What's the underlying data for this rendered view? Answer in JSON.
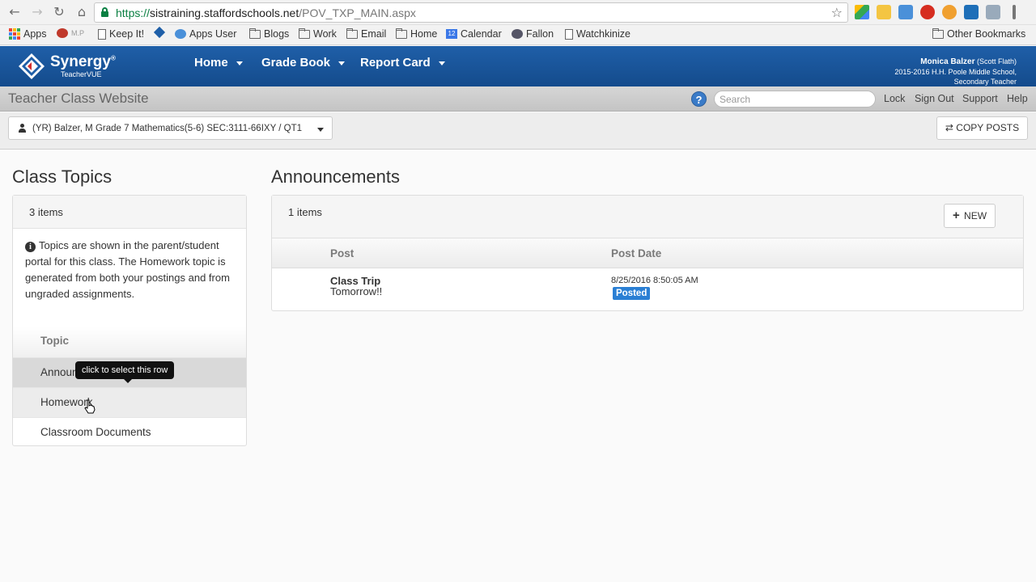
{
  "browser": {
    "url_scheme": "https://",
    "url_host": "sistraining.staffordschools.net",
    "url_path": "/POV_TXP_MAIN.aspx",
    "bookmarks": [
      "Apps",
      "M.P",
      "Keep It!",
      "Apps User",
      "Blogs",
      "Work",
      "Email",
      "Home",
      "Calendar",
      "Fallon",
      "Watchkinize"
    ],
    "other_bookmarks": "Other Bookmarks",
    "calendar_badge": "12"
  },
  "app": {
    "logo": "Synergy",
    "logo_mark": "®",
    "logo_sub": "TeacherVUE",
    "nav": [
      "Home",
      "Grade Book",
      "Report Card"
    ],
    "user_name": "Monica Balzer",
    "user_alt": "(Scott Flath)",
    "user_school": "2015-2016 H.H. Poole Middle School,",
    "user_role": "Secondary Teacher"
  },
  "titlebar": {
    "title": "Teacher Class Website",
    "help": "?",
    "search_placeholder": "Search",
    "links": [
      "Lock",
      "Sign Out",
      "Support",
      "Help"
    ]
  },
  "section": {
    "selected": "(YR) Balzer, M Grade 7 Mathematics(5-6) SEC:3111-66IXY / QT1",
    "copy_posts": "COPY POSTS",
    "copy_icon": "⇄"
  },
  "topics": {
    "title": "Class Topics",
    "count": "3 items",
    "info": "Topics are shown in the parent/student portal for this class. The Homework topic is generated from both your postings and from ungraded assignments.",
    "column": "Topic",
    "rows": [
      "Announcements",
      "Homework",
      "Classroom Documents"
    ],
    "tooltip": "click to select this row"
  },
  "announcements": {
    "title": "Announcements",
    "count": "1 items",
    "new_label": "NEW",
    "col_post": "Post",
    "col_date": "Post Date",
    "rows": [
      {
        "title": "Class Trip",
        "subtitle": "Tomorrow!!",
        "date": "8/25/2016 8:50:05 AM",
        "status": "Posted"
      }
    ]
  },
  "colors": {
    "header_blue": "#1f5fa8",
    "badge_blue": "#2a7fd4"
  }
}
